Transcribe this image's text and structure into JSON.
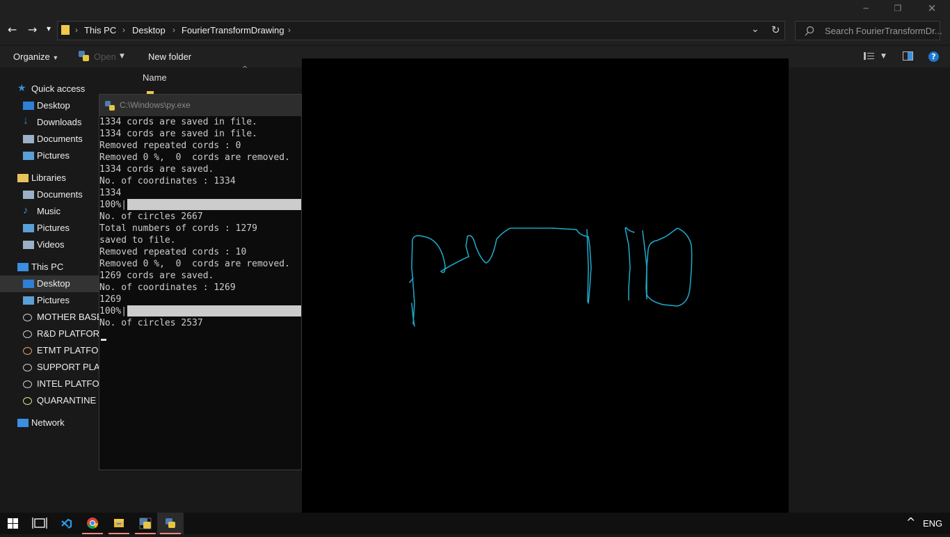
{
  "window": {
    "controls": {
      "minimize": "─",
      "restore": "❐",
      "close": "✕"
    }
  },
  "nav_buttons": {
    "back": "←",
    "forward": "→",
    "recent": "▾",
    "up_dropdown": "⌄",
    "refresh": "↻"
  },
  "breadcrumb": [
    "This PC",
    "Desktop",
    "FourierTransformDrawing"
  ],
  "search": {
    "placeholder": "Search FourierTransformDr..."
  },
  "toolbar": {
    "organize": "Organize",
    "open": "Open",
    "new_folder": "New folder"
  },
  "sidebar": {
    "items": [
      {
        "label": "Quick access",
        "icon": "star-icon",
        "color": "#3b8ee0"
      },
      {
        "label": "Desktop",
        "icon": "desktop-icon",
        "color": "#2f7fd6"
      },
      {
        "label": "Downloads",
        "icon": "download-icon",
        "color": "#2f7fd6"
      },
      {
        "label": "Documents",
        "icon": "document-icon",
        "color": "#9bb0c8"
      },
      {
        "label": "Pictures",
        "icon": "picture-icon",
        "color": "#5aa0d8"
      },
      {
        "label": "Libraries",
        "icon": "library-icon",
        "color": "#e8c35b"
      },
      {
        "label": "Documents",
        "icon": "document-icon",
        "color": "#9bb0c8"
      },
      {
        "label": "Music",
        "icon": "music-icon",
        "color": "#3b8ee0"
      },
      {
        "label": "Pictures",
        "icon": "picture-icon",
        "color": "#5aa0d8"
      },
      {
        "label": "Videos",
        "icon": "video-icon",
        "color": "#9bb0c8"
      },
      {
        "label": "This PC",
        "icon": "computer-icon",
        "color": "#3b8ee0"
      },
      {
        "label": "Desktop",
        "icon": "desktop-icon",
        "color": "#2f7fd6"
      },
      {
        "label": "Pictures",
        "icon": "picture-icon",
        "color": "#5aa0d8"
      },
      {
        "label": "MOTHER BASE",
        "icon": "drive-icon",
        "color": "#cfcfcf"
      },
      {
        "label": "R&D PLATFORM",
        "icon": "drive-icon",
        "color": "#cfcfcf"
      },
      {
        "label": "ETMT PLATFORM",
        "icon": "drive-icon",
        "color": "#e8a070"
      },
      {
        "label": "SUPPORT PLATFORM",
        "icon": "drive-icon",
        "color": "#cfcfcf"
      },
      {
        "label": "INTEL PLATFORM",
        "icon": "drive-icon",
        "color": "#cfcfcf"
      },
      {
        "label": "QUARANTINE PLATFORM",
        "icon": "drive-icon",
        "color": "#e8e08a"
      },
      {
        "label": "Network",
        "icon": "network-icon",
        "color": "#3b8ee0"
      }
    ]
  },
  "file_list": {
    "column_name": "Name"
  },
  "console": {
    "title": "C:\\Windows\\py.exe",
    "lines": [
      "1334 cords are saved in file.",
      "1334 cords are saved in file.",
      "Removed repeated cords : 0",
      "Removed 0 %,  0  cords are removed.",
      "1334 cords are saved.",
      "No. of coordinates : 1334",
      "1334",
      "100%|",
      "No. of circles 2667",
      "Total numbers of cords : 1279",
      "saved to file.",
      "Removed repeated cords : 10",
      "Removed 0 %,  0  cords are removed.",
      "1269 cords are saved.",
      "No. of coordinates : 1269",
      "1269",
      "100%|",
      "No. of circles 2537"
    ],
    "progress_fraction": 1.0
  },
  "drawing": {
    "stroke_color": "#1fa8c8",
    "background": "#000000"
  },
  "taskbar": {
    "items": [
      "windows-start-icon",
      "task-view-icon",
      "vscode-icon",
      "chrome-icon",
      "file-explorer-icon",
      "python-icon",
      "python-running-icon"
    ],
    "language": "ENG",
    "tray_chevron": "^"
  }
}
